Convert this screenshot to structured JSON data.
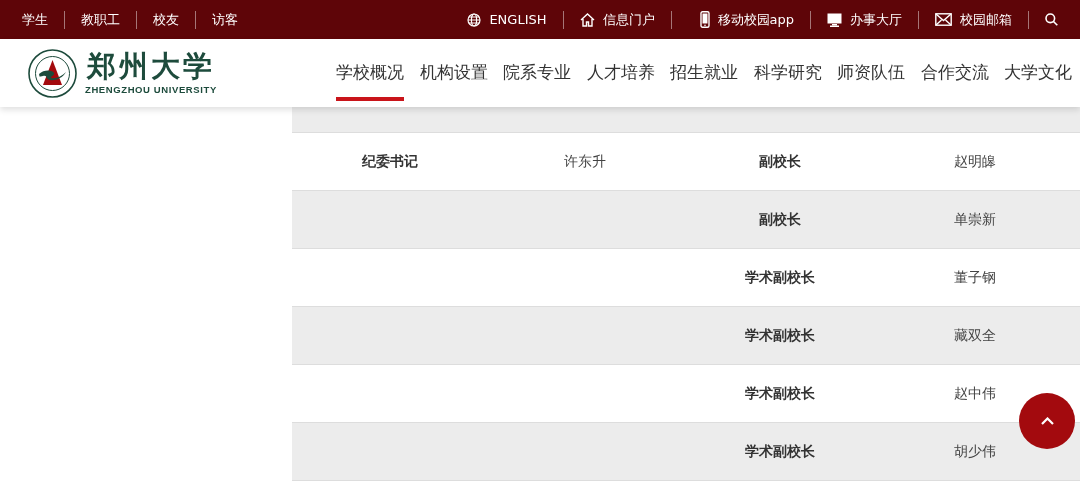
{
  "top_bar": {
    "left_links": [
      "学生",
      "教职工",
      "校友",
      "访客"
    ],
    "right_links": [
      {
        "kind": "globe",
        "label": "ENGLISH"
      },
      {
        "kind": "home",
        "label": "信息门户"
      },
      {
        "kind": "phone",
        "label": "移动校园app"
      },
      {
        "kind": "monitor",
        "label": "办事大厅"
      },
      {
        "kind": "mail",
        "label": "校园邮箱"
      },
      {
        "kind": "search"
      }
    ]
  },
  "logo": {
    "name_cn": "郑州大学",
    "name_en": "ZHENGZHOU UNIVERSITY"
  },
  "nav": [
    {
      "label": "学校概况",
      "selected": true
    },
    {
      "label": "机构设置",
      "selected": false
    },
    {
      "label": "院系专业",
      "selected": false
    },
    {
      "label": "人才培养",
      "selected": false
    },
    {
      "label": "招生就业",
      "selected": false
    },
    {
      "label": "科学研究",
      "selected": false
    },
    {
      "label": "师资队伍",
      "selected": false
    },
    {
      "label": "合作交流",
      "selected": false
    },
    {
      "label": "大学文化",
      "selected": false
    }
  ],
  "table": {
    "rows": [
      {
        "column_1": "纪委书记",
        "column_2": "许东升",
        "column_3": "副校长",
        "column_4": "赵明皞"
      },
      {
        "column_3": "副校长",
        "column_4": "单崇新"
      },
      {
        "column_3": "学术副校长",
        "column_4": "董子钢"
      },
      {
        "column_3": "学术副校长",
        "column_4": "藏双全"
      },
      {
        "column_3": "学术副校长",
        "column_4": "赵中伟"
      },
      {
        "column_3": "学术副校长",
        "column_4": "胡少伟"
      }
    ]
  },
  "back_to_top": {
    "kind": "chevron"
  }
}
